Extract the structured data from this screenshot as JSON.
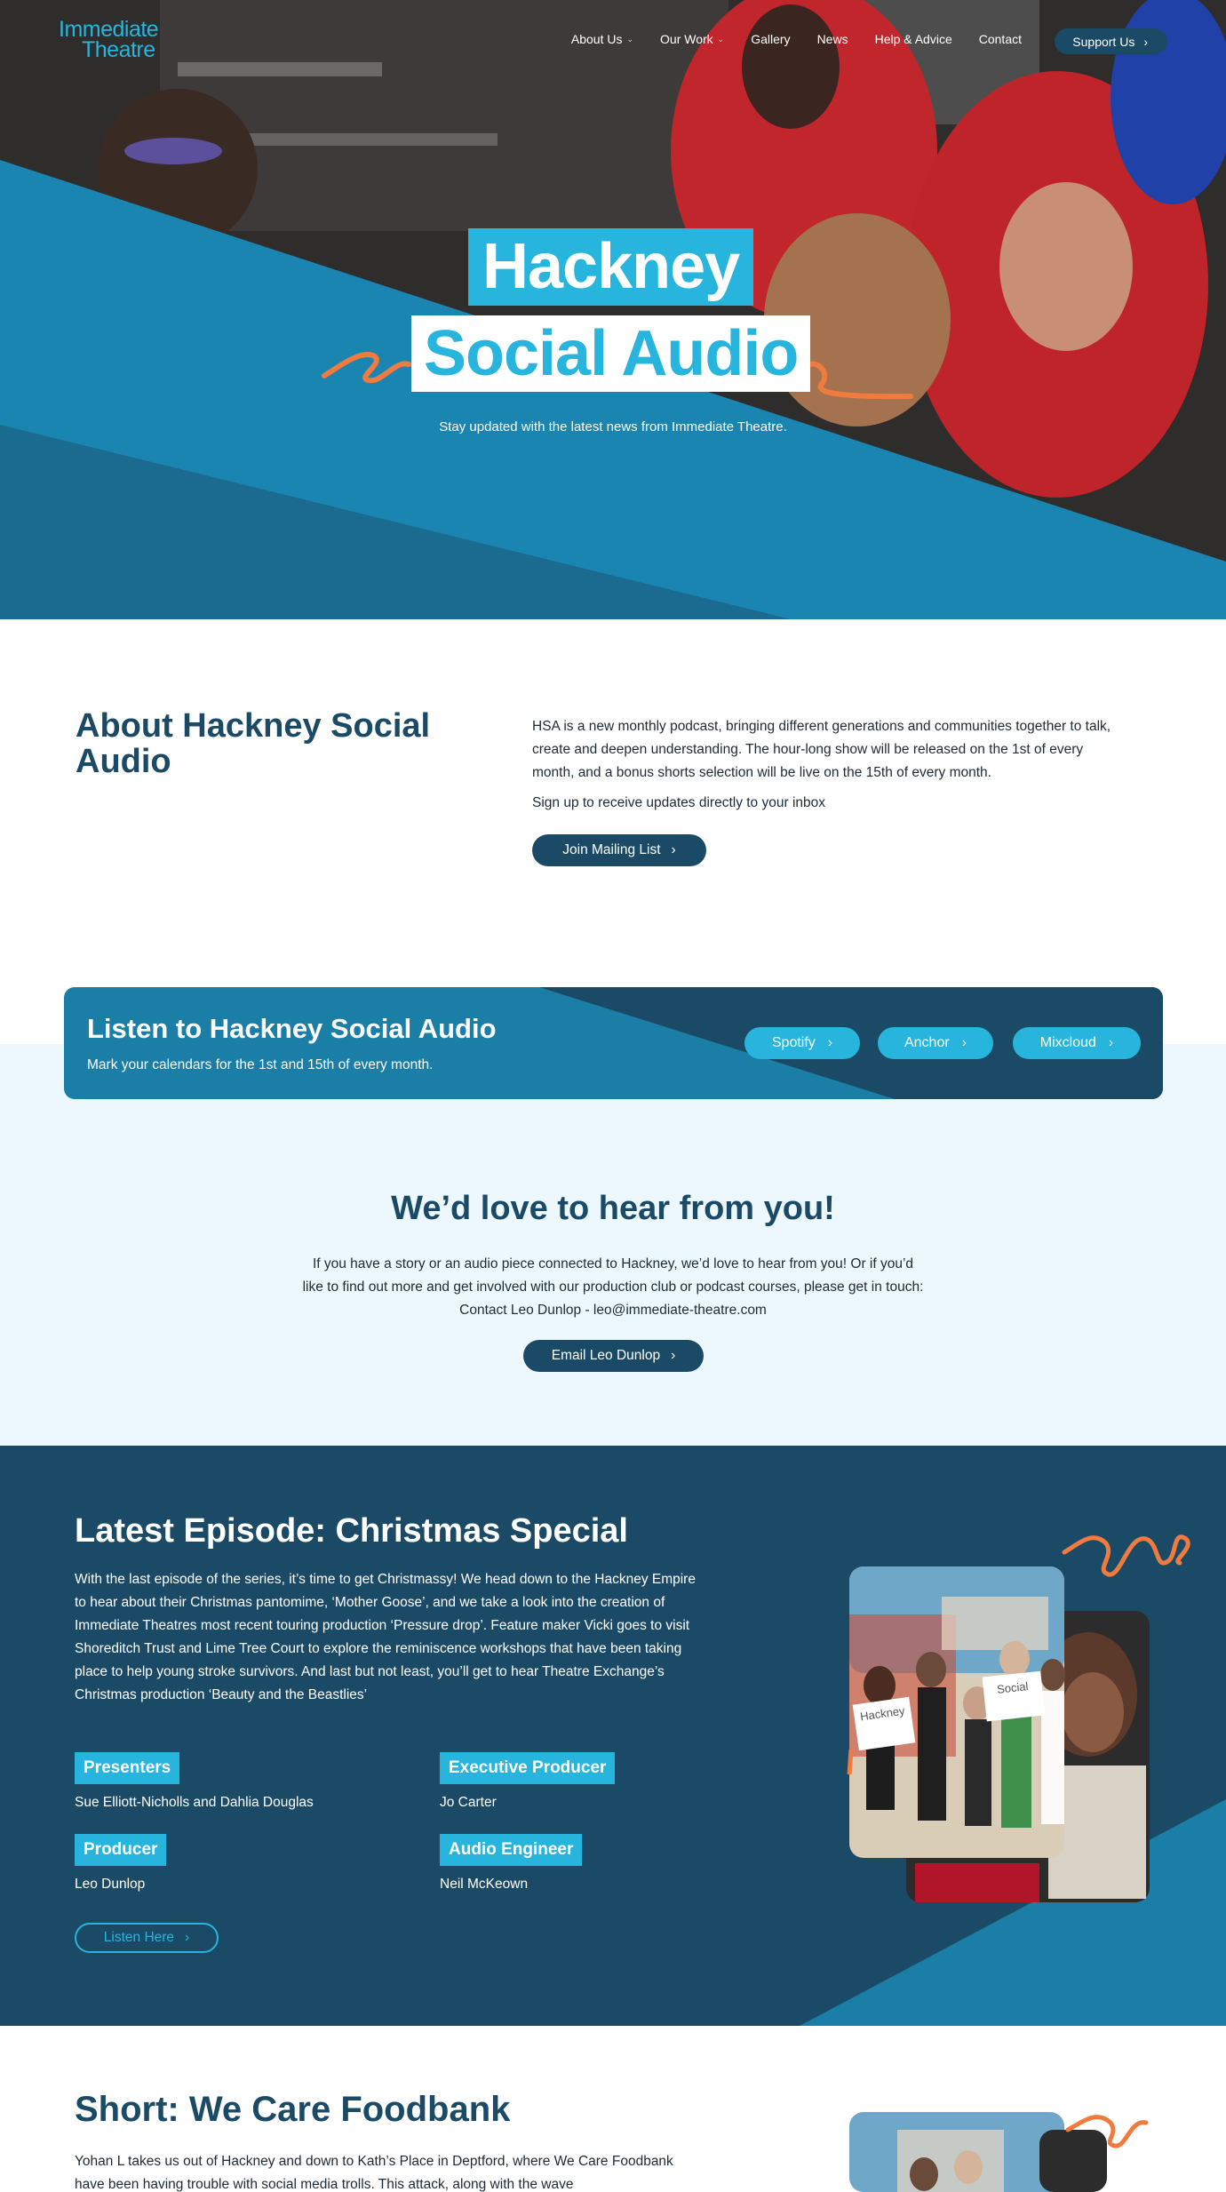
{
  "header": {
    "logo_line1": "Immediate",
    "logo_line2": "Theatre",
    "nav": [
      {
        "label": "About Us",
        "has_dropdown": true
      },
      {
        "label": "Our Work",
        "has_dropdown": true
      },
      {
        "label": "Gallery",
        "has_dropdown": false
      },
      {
        "label": "News",
        "has_dropdown": false
      },
      {
        "label": "Help & Advice",
        "has_dropdown": false
      },
      {
        "label": "Contact",
        "has_dropdown": false
      }
    ],
    "support_label": "Support Us"
  },
  "hero": {
    "title_line1": "Hackney",
    "title_line2": "Social Audio",
    "subtitle": "Stay updated with the latest news from Immediate Theatre."
  },
  "about": {
    "title": "About Hackney Social Audio",
    "body": "HSA is a new monthly podcast, bringing different generations and communities together to talk, create and deepen understanding. The hour-long show will be released on the 1st of every month, and a bonus shorts selection will be live on the 15th of every month.",
    "signup_text": "Sign up to receive updates directly to your inbox",
    "button_label": "Join Mailing List"
  },
  "listen": {
    "title": "Listen to Hackney Social Audio",
    "subtitle": "Mark your calendars for the 1st and 15th of every month.",
    "platforms": [
      "Spotify",
      "Anchor",
      "Mixcloud"
    ]
  },
  "contact": {
    "title": "We’d love to hear from you!",
    "body": "If you have a story or an audio piece connected to Hackney, we’d love to hear from you! Or if you’d like to find out more and get involved with our production club or podcast courses, please get in touch: Contact Leo Dunlop - leo@immediate-theatre.com",
    "button_label": "Email Leo Dunlop"
  },
  "episode": {
    "title": "Latest Episode: Christmas Special",
    "body": "With the last episode of the series, it’s time to get Christmassy! We head down to the Hackney Empire to hear about their Christmas pantomime, ‘Mother Goose’, and we take a look into the creation of Immediate Theatres most recent touring production ‘Pressure drop’. Feature maker Vicki goes to visit Shoreditch Trust and Lime Tree Court to explore the reminiscence workshops that have been taking place to help young stroke survivors. And last but not least, you’ll get to hear Theatre Exchange’s Christmas production ‘Beauty and the Beastlies’",
    "credits": [
      {
        "role": "Presenters",
        "name": "Sue Elliott-Nicholls and Dahlia Douglas"
      },
      {
        "role": "Executive Producer",
        "name": "Jo Carter"
      },
      {
        "role": "Producer",
        "name": "Leo Dunlop"
      },
      {
        "role": "Audio Engineer",
        "name": "Neil McKeown"
      }
    ],
    "button_label": "Listen Here",
    "sign_left": "Hackney",
    "sign_right": "Social"
  },
  "short": {
    "title": "Short: We Care Foodbank",
    "body": "Yohan L takes us out of Hackney and down to Kath’s Place in Deptford, where We Care Foodbank have been having trouble with social media trolls. This attack, along with the wave"
  },
  "colors": {
    "accent": "#27b5dd",
    "navy": "#1b4a66",
    "teal": "#1a7ea6",
    "orange": "#f07b3f",
    "light_band": "#ecf8fd"
  },
  "icons": [
    "chevron-down-icon",
    "chevron-right-icon",
    "orange-squiggle"
  ]
}
